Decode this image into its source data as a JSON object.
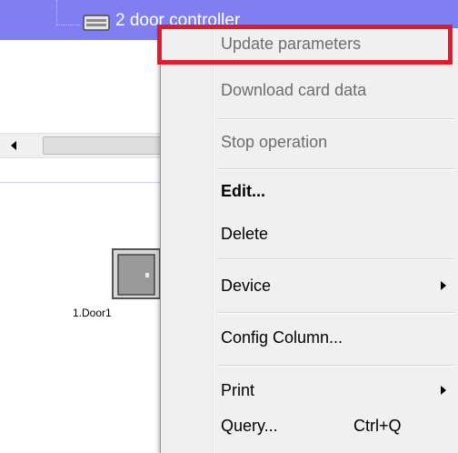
{
  "tree": {
    "selected_node_label": "2 door controller"
  },
  "panel": {
    "door_label": "1.Door1"
  },
  "context_menu": {
    "items": [
      {
        "label": "Update parameters",
        "disabled": true
      },
      {
        "label": "Download card data",
        "disabled": true
      },
      {
        "label": "Stop operation",
        "disabled": true
      },
      {
        "label": "Edit...",
        "bold": true
      },
      {
        "label": "Delete"
      },
      {
        "label": "Device",
        "submenu": true
      },
      {
        "label": "Config Column..."
      },
      {
        "label": "Print",
        "submenu": true
      },
      {
        "label": "Query...",
        "shortcut": "Ctrl+Q"
      }
    ]
  },
  "colors": {
    "selection_blue": "#7f7ff2",
    "menu_background": "#f0f0f0",
    "highlight_red": "#e3192c",
    "disabled_text": "#6d6d6d"
  },
  "icons": [
    "device-icon",
    "scroll-left-arrow-icon",
    "door-icon",
    "submenu-arrow-icon"
  ]
}
